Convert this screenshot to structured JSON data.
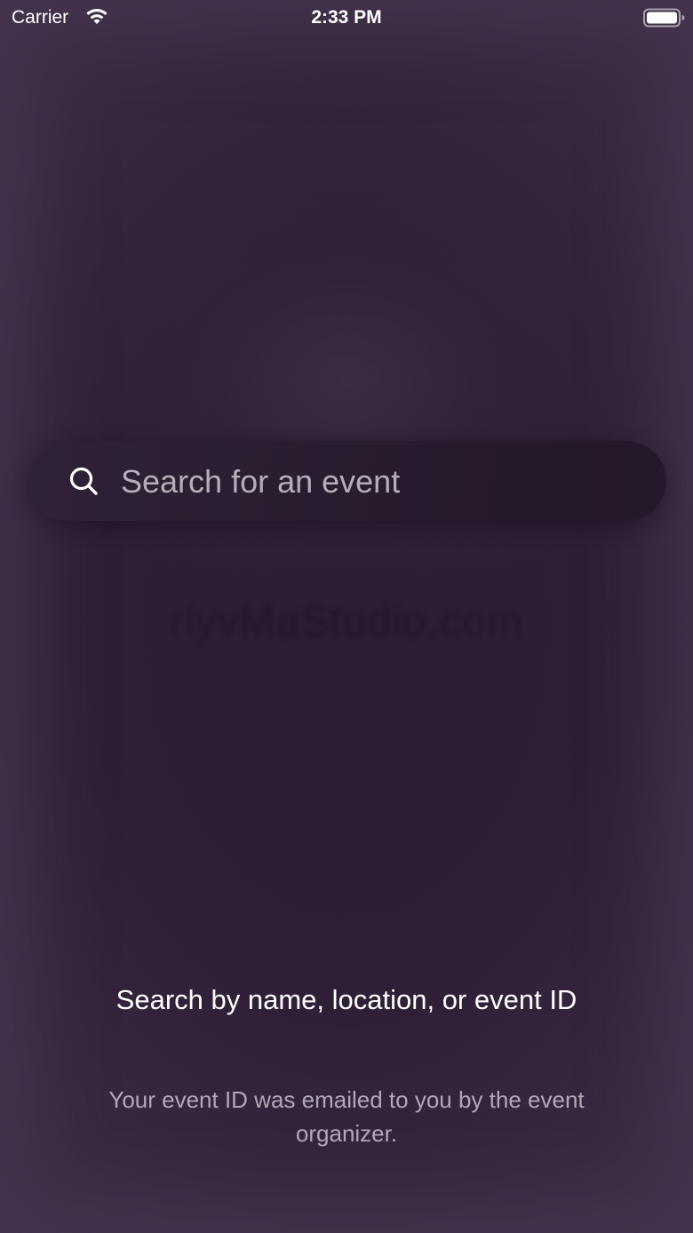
{
  "status_bar": {
    "carrier": "Carrier",
    "time": "2:33 PM",
    "wifi_icon": "wifi-icon",
    "battery_icon": "battery-full-icon",
    "battery_level": 1.0
  },
  "background": {
    "logo_text": "rlyvMaStudio.com"
  },
  "search": {
    "placeholder": "Search for an event",
    "value": "",
    "icon": "search-icon"
  },
  "helper": {
    "title": "Search by name, location, or event ID",
    "subtitle": "Your event ID was emailed to you by the event organizer."
  },
  "colors": {
    "background": "#2e1f35",
    "search_bar": "#2b1c30",
    "text_primary": "#ffffff",
    "text_secondary": "#cdc4d2"
  }
}
